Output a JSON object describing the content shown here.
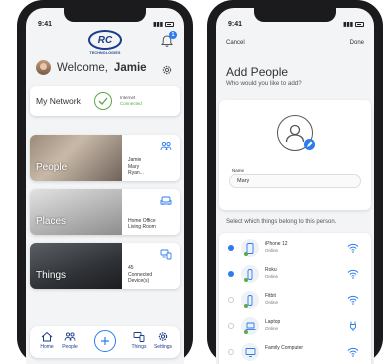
{
  "left": {
    "status": {
      "time": "9:41"
    },
    "brand": {
      "logo_text": "RC",
      "logo_sub": "TECHNOLOGIES"
    },
    "notifications": {
      "badge": "1"
    },
    "welcome": {
      "greeting": "Welcome,",
      "name": "Jamie"
    },
    "network": {
      "label": "My Network",
      "status_key": "Internet",
      "status_value": "Connected"
    },
    "cards": {
      "people": {
        "title": "People",
        "lines": [
          "Jamie",
          "Mary",
          "Ryan..."
        ]
      },
      "places": {
        "title": "Places",
        "lines": [
          "Home Office",
          "Living Room"
        ]
      },
      "things": {
        "title": "Things",
        "lines": [
          "45",
          "Connected",
          "Device(s)"
        ]
      }
    },
    "nav": {
      "home": "Home",
      "people": "People",
      "things": "Things",
      "settings": "Settings"
    }
  },
  "right": {
    "status": {
      "time": "9:41"
    },
    "topbar": {
      "cancel": "Cancel",
      "done": "Done"
    },
    "title": "Add People",
    "subtitle": "Who would you like to add?",
    "name_label": "Name",
    "name_value": "Mary",
    "belongs_prompt": "Select which things belong to this person.",
    "devices": [
      {
        "name": "iPhone 12",
        "status": "Online",
        "selected": true
      },
      {
        "name": "Roku",
        "status": "Online",
        "selected": true
      },
      {
        "name": "Fitbit",
        "status": "Online",
        "selected": false
      },
      {
        "name": "Laptop",
        "status": "Online",
        "selected": false
      },
      {
        "name": "Family Computer",
        "status": "",
        "selected": false
      }
    ]
  },
  "colors": {
    "brand_blue": "#1c3b8b",
    "accent_blue": "#2d7bf0",
    "online_green": "#5aa84a"
  }
}
